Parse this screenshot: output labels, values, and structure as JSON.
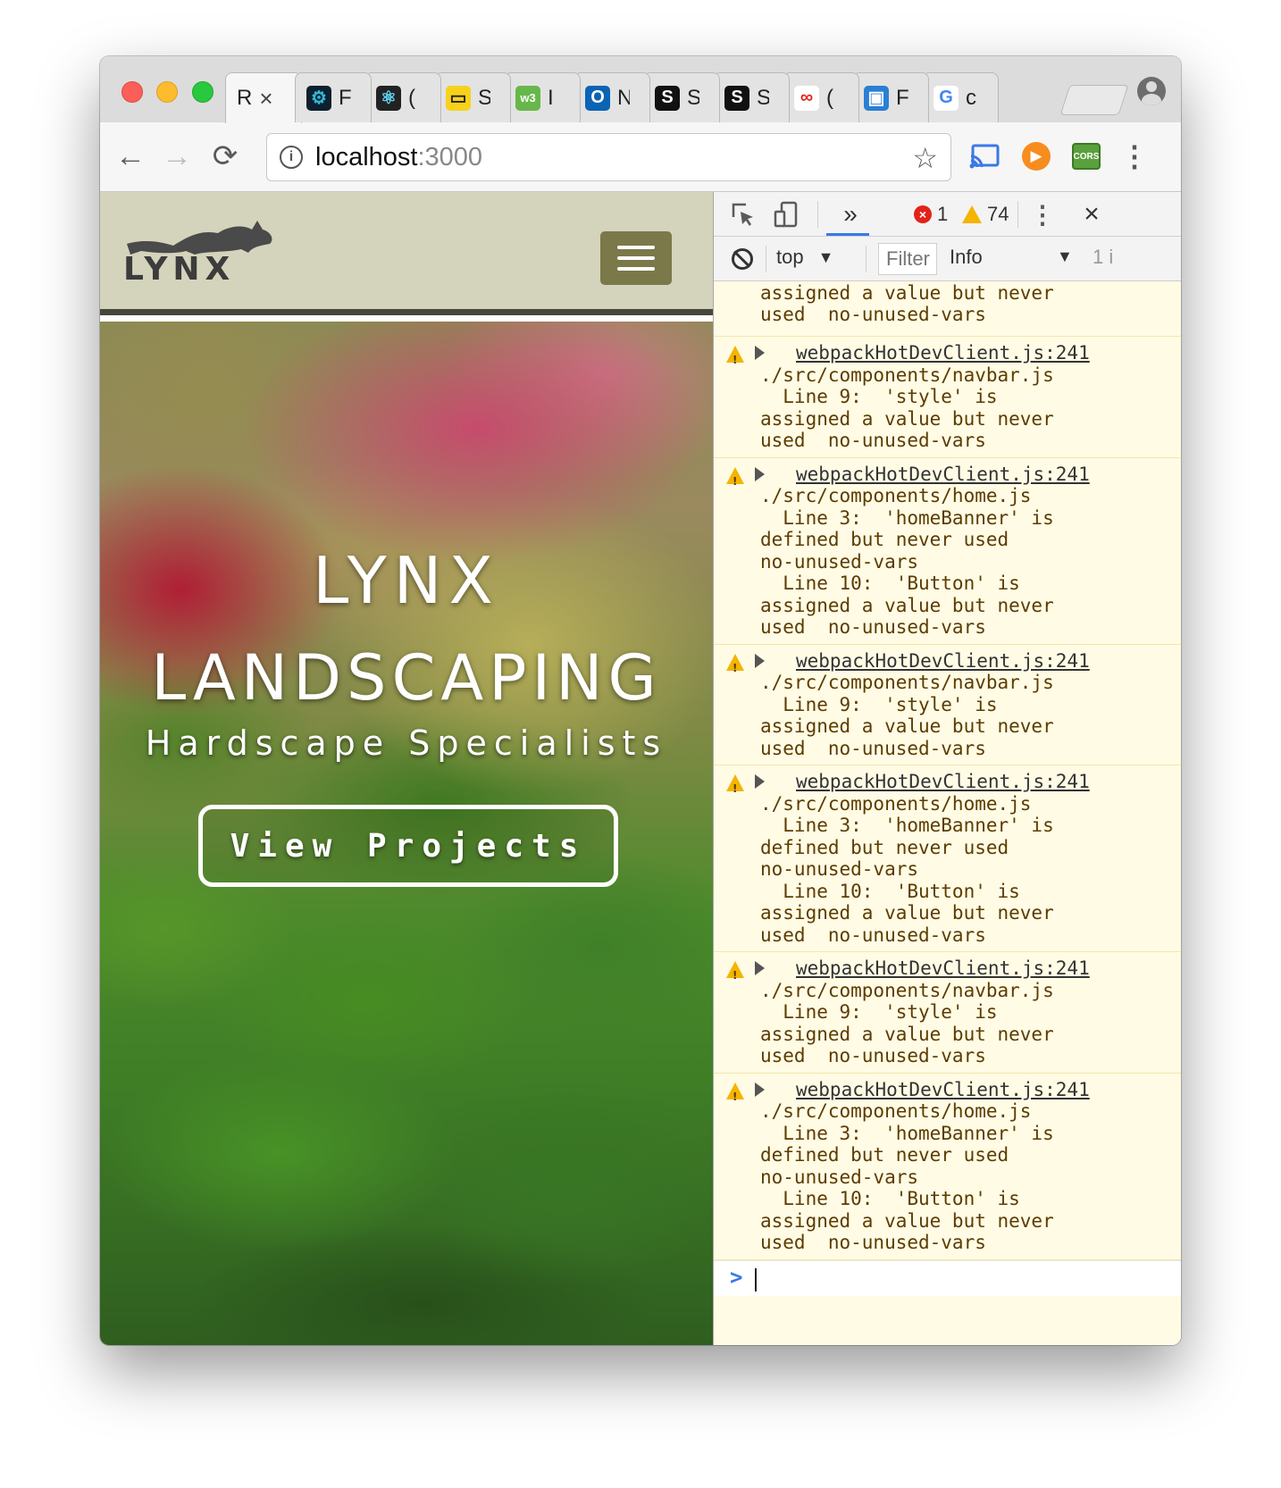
{
  "browser": {
    "tabs": [
      {
        "title": "R",
        "favicon": "react-icon",
        "color": "#ffffff",
        "fg": "#222222",
        "active": true
      },
      {
        "title": "F",
        "favicon": "redux-icon",
        "color": "#0e1f2f",
        "fg": "#30b9d8"
      },
      {
        "title": "(",
        "favicon": "react-atom-icon",
        "color": "#222222",
        "fg": "#61dafb"
      },
      {
        "title": "S",
        "favicon": "toggle-icon",
        "color": "#f7d21b",
        "fg": "#222222"
      },
      {
        "title": "I",
        "favicon": "w3-icon",
        "color": "#68b74a",
        "fg": "#ffffff"
      },
      {
        "title": "N",
        "favicon": "outlook-icon",
        "color": "#0a64b4",
        "fg": "#ffffff"
      },
      {
        "title": "S",
        "favicon": "s-icon",
        "color": "#111111",
        "fg": "#ffffff"
      },
      {
        "title": "S",
        "favicon": "s-icon",
        "color": "#111111",
        "fg": "#ffffff"
      },
      {
        "title": "(",
        "favicon": "infinity-icon",
        "color": "#ffffff",
        "fg": "#e2231a"
      },
      {
        "title": "F",
        "favicon": "square-icon",
        "color": "#2a7fd4",
        "fg": "#ffffff"
      },
      {
        "title": "c",
        "favicon": "google-icon",
        "color": "#ffffff",
        "fg": "#4285f4"
      }
    ],
    "tab_close_glyph": "×",
    "omnibox": {
      "host": "localhost",
      "port": ":3000"
    },
    "icons": {
      "back": "←",
      "forward": "→",
      "reload": "⟳",
      "star": "☆",
      "menu": "⋮",
      "info": "i",
      "cors": "CORS",
      "play": "▶"
    }
  },
  "site": {
    "logo_text": "LYNX",
    "hero_title_1": "LYNX",
    "hero_title_2": "LANDSCAPING",
    "hero_subtitle": "Hardscape Specialists",
    "cta_label": "View Projects",
    "colors": {
      "nav_bg": "#d4d3bb",
      "hamburger_bg": "#7b784a"
    }
  },
  "devtools": {
    "more_tabs": "»",
    "error_count": "1",
    "error_glyph": "×",
    "warning_count": "74",
    "kebab": "⋮",
    "close": "×",
    "context": "top",
    "context_caret": "▼",
    "filter_placeholder": "Filter",
    "level": "Info",
    "level_caret": "▼",
    "hidden_count": "1 i",
    "partial_message": "  Line 10:  'Button' is\nassigned a value but never\nused  no-unused-vars",
    "messages": [
      {
        "source": "webpackHotDevClient.js:241",
        "body": "./src/components/navbar.js\n  Line 9:  'style' is\nassigned a value but never\nused  no-unused-vars"
      },
      {
        "source": "webpackHotDevClient.js:241",
        "body": "./src/components/home.js\n  Line 3:  'homeBanner' is\ndefined but never used\nno-unused-vars\n  Line 10:  'Button' is\nassigned a value but never\nused  no-unused-vars"
      },
      {
        "source": "webpackHotDevClient.js:241",
        "body": "./src/components/navbar.js\n  Line 9:  'style' is\nassigned a value but never\nused  no-unused-vars"
      },
      {
        "source": "webpackHotDevClient.js:241",
        "body": "./src/components/home.js\n  Line 3:  'homeBanner' is\ndefined but never used\nno-unused-vars\n  Line 10:  'Button' is\nassigned a value but never\nused  no-unused-vars"
      },
      {
        "source": "webpackHotDevClient.js:241",
        "body": "./src/components/navbar.js\n  Line 9:  'style' is\nassigned a value but never\nused  no-unused-vars"
      },
      {
        "source": "webpackHotDevClient.js:241",
        "body": "./src/components/home.js\n  Line 3:  'homeBanner' is\ndefined but never used\nno-unused-vars\n  Line 10:  'Button' is\nassigned a value but never\nused  no-unused-vars"
      }
    ],
    "prompt_glyph": ">"
  }
}
